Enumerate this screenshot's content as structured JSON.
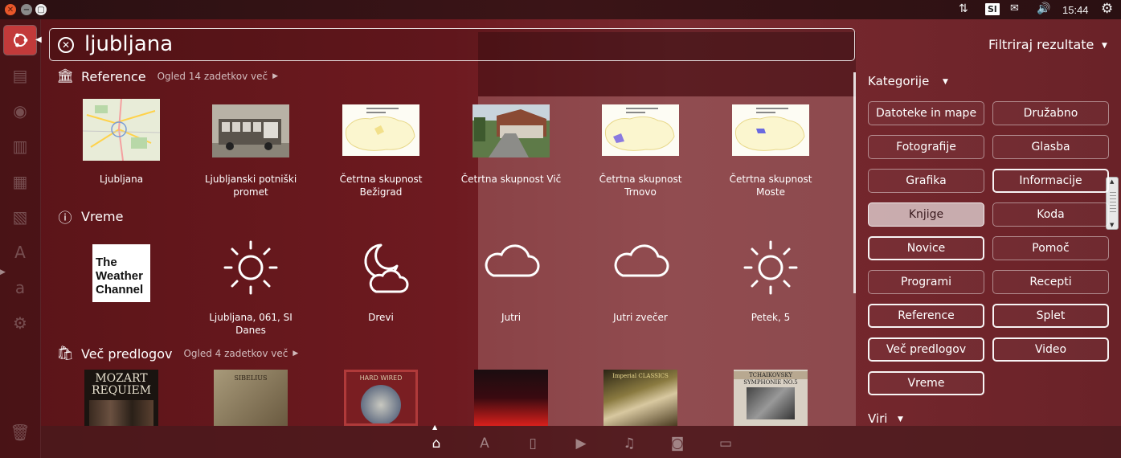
{
  "top_panel": {
    "keyboard_layout": "Sl",
    "clock": "15:44"
  },
  "search": {
    "query": "ljubljana"
  },
  "filter": {
    "title": "Filtriraj rezultate",
    "categories_title": "Kategorije",
    "sources_title": "Viri",
    "buttons": [
      {
        "label": "Datoteke in mape",
        "state": "normal"
      },
      {
        "label": "Družabno",
        "state": "normal"
      },
      {
        "label": "Fotografije",
        "state": "normal"
      },
      {
        "label": "Glasba",
        "state": "normal"
      },
      {
        "label": "Grafika",
        "state": "normal"
      },
      {
        "label": "Informacije",
        "state": "bright"
      },
      {
        "label": "Knjige",
        "state": "active"
      },
      {
        "label": "Koda",
        "state": "normal"
      },
      {
        "label": "Novice",
        "state": "bright"
      },
      {
        "label": "Pomoč",
        "state": "normal"
      },
      {
        "label": "Programi",
        "state": "normal"
      },
      {
        "label": "Recepti",
        "state": "normal"
      },
      {
        "label": "Reference",
        "state": "bright"
      },
      {
        "label": "Splet",
        "state": "bright"
      },
      {
        "label": "Več predlogov",
        "state": "bright"
      },
      {
        "label": "Video",
        "state": "bright"
      },
      {
        "label": "Vreme",
        "state": "bright"
      }
    ]
  },
  "results": {
    "reference": {
      "title": "Reference",
      "more": "Ogled 14 zadetkov več",
      "items": [
        {
          "label_1": "Ljubljana",
          "label_2": ""
        },
        {
          "label_1": "Ljubljanski potniški",
          "label_2": "promet"
        },
        {
          "label_1": "Četrtna skupnost",
          "label_2": "Bežigrad"
        },
        {
          "label_1": "Četrtna skupnost Vič",
          "label_2": ""
        },
        {
          "label_1": "Četrtna skupnost",
          "label_2": "Trnovo"
        },
        {
          "label_1": "Četrtna skupnost",
          "label_2": "Moste"
        }
      ]
    },
    "weather": {
      "title": "Vreme",
      "provider_logo_text": [
        "The",
        "Weather",
        "Channel"
      ],
      "items": [
        {
          "label_1": "Ljubljana, 061, SI",
          "label_2": "Danes",
          "icon": "sun-icon"
        },
        {
          "label_1": "Drevi",
          "label_2": "",
          "icon": "moon-cloud-icon"
        },
        {
          "label_1": "Jutri",
          "label_2": "",
          "icon": "cloud-icon"
        },
        {
          "label_1": "Jutri zvečer",
          "label_2": "",
          "icon": "cloud-icon"
        },
        {
          "label_1": "Petek, 5",
          "label_2": "",
          "icon": "sun-icon"
        }
      ]
    },
    "more_suggestions": {
      "title": "Več predlogov",
      "more": "Ogled 4 zadetkov več",
      "albums": [
        {
          "line_1": "MOZART",
          "line_2": "REQUIEM",
          "bg": "#1a1410",
          "fg": "#e9e2cf"
        },
        {
          "line_1": "SIBELIUS",
          "line_2": "",
          "bg": "#8a7a5c",
          "fg": "#2a2015"
        },
        {
          "line_1": "HARD WIRED",
          "line_2": "",
          "bg": "#7a1e22",
          "fg": "#d8c8a8"
        },
        {
          "line_1": "",
          "line_2": "",
          "bg": "#1b0d10",
          "fg": "#e0c0b0"
        },
        {
          "line_1": "Imperial CLASSICS",
          "line_2": "",
          "bg": "#2a2414",
          "fg": "#e8d890"
        },
        {
          "line_1": "TCHAIKOVSKY",
          "line_2": "SYMPHONIE NO.5",
          "bg": "#d8d0c4",
          "fg": "#222"
        }
      ]
    }
  },
  "lens_bar": {
    "lenses": [
      "home-icon",
      "apps-icon",
      "files-icon",
      "video-icon",
      "music-icon",
      "photo-icon",
      "social-icon"
    ],
    "active": "home-icon"
  }
}
